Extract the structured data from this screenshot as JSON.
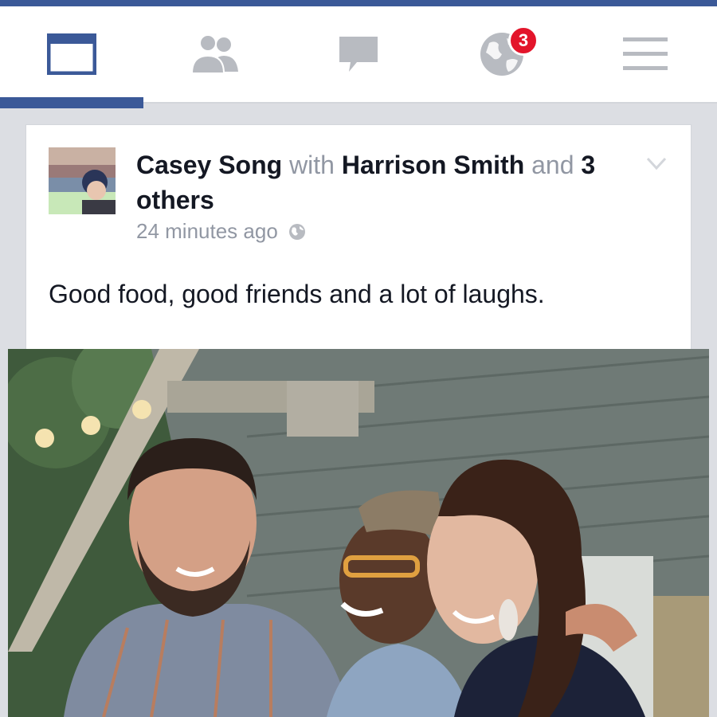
{
  "tabs": [
    {
      "name": "news-feed",
      "icon": "news-feed-icon",
      "active": true
    },
    {
      "name": "friend-requests",
      "icon": "friends-icon"
    },
    {
      "name": "messages",
      "icon": "chat-bubble-icon"
    },
    {
      "name": "notifications",
      "icon": "globe-icon",
      "badge": "3"
    },
    {
      "name": "more",
      "icon": "hamburger-menu-icon"
    }
  ],
  "colors": {
    "brand": "#3b5998",
    "badge": "#e3152b",
    "icon_gray": "#b8bbc1",
    "muted_text": "#9197a3"
  },
  "post": {
    "author": "Casey Song",
    "with_word": "with",
    "tagged": "Harrison Smith",
    "and_word": "and",
    "others": "3 others",
    "time": "24 minutes ago",
    "privacy_icon": "public-globe-icon",
    "text": "Good food, good friends and a lot of laughs."
  }
}
